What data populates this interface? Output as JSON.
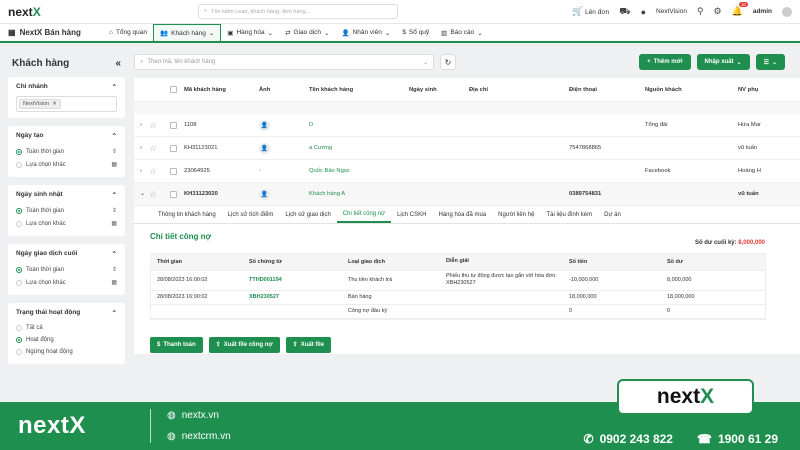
{
  "topbar": {
    "logo_main": "next",
    "logo_x": "X",
    "search_placeholder": "Tìm kiếm Lead, khách hàng, đơn hàng...",
    "order_label": "Lên đơn",
    "company": "NextVision",
    "notif_count": "10",
    "user": "admin"
  },
  "nav": {
    "brand": "NextX Bán hàng",
    "items": [
      "Tổng quan",
      "Khách hàng",
      "Hàng hóa",
      "Giao dịch",
      "Nhân viên",
      "Sổ quỹ",
      "Báo cáo"
    ]
  },
  "sidebar": {
    "title": "Khách hàng",
    "branch": {
      "title": "Chi nhánh",
      "tag": "NextVision"
    },
    "created": {
      "title": "Ngày tạo",
      "opt1": "Toàn thời gian",
      "opt2": "Lựa chọn khác"
    },
    "birthday": {
      "title": "Ngày sinh nhật",
      "opt1": "Toàn thời gian",
      "opt2": "Lựa chọn khác"
    },
    "last_txn": {
      "title": "Ngày giao dịch cuối",
      "opt1": "Toàn thời gian",
      "opt2": "Lựa chọn khác"
    },
    "status": {
      "title": "Trạng thái hoạt động",
      "opt1": "Tất cả",
      "opt2": "Hoạt động",
      "opt3": "Ngừng hoạt động"
    }
  },
  "main": {
    "search_placeholder": "Theo mã, tên khách hàng",
    "add_label": "Thêm mới",
    "import_label": "Nhập xuất",
    "columns": [
      "Mã khách hàng",
      "Ảnh",
      "Tên khách hàng",
      "Ngày sinh",
      "Địa chỉ",
      "Điện thoại",
      "Nguồn khách",
      "NV phụ"
    ],
    "rows": [
      {
        "code": "1108",
        "name": "D",
        "phone": "",
        "source": "Tổng đài",
        "staff": "Hứa Mar"
      },
      {
        "code": "KH31123021",
        "name": "a Cường",
        "phone": "7547868865",
        "source": "",
        "staff": "vũ tuấn"
      },
      {
        "code": "23064925",
        "name": "Quốc Bảo Ngọc",
        "phone": "",
        "source": "Facebook",
        "staff": "Hoàng H"
      },
      {
        "code": "KH31123020",
        "name": "Khách hàng A",
        "phone": "0389754831",
        "source": "",
        "staff": "vũ tuấn"
      }
    ],
    "tabs": [
      "Thông tin khách hàng",
      "Lịch sử tích điểm",
      "Lịch sử giao dịch",
      "Chi tiết công nợ",
      "Lịch CSKH",
      "Hàng hóa đã mua",
      "Người liên hệ",
      "Tài liệu đính kèm",
      "Dự án"
    ],
    "detail": {
      "title": "Chi tiết công nợ",
      "balance_label": "Số dư cuối kỳ:",
      "balance_value": "8,000,000",
      "columns": [
        "Thời gian",
        "Số chứng từ",
        "Loại giao dịch",
        "Diễn giải",
        "Số tiền",
        "Số dư"
      ],
      "rows": [
        {
          "time": "28/08/2023 16:00:02",
          "doc": "TTHD001194",
          "type": "Thu tiền khách trả",
          "desc": "Phiếu thu tự động được tạo gắn với hóa đơn: XBH230527",
          "amount": "-10,000,000",
          "balance": "8,000,000"
        },
        {
          "time": "28/08/2023 16:00:02",
          "doc": "XBH230527",
          "type": "Bán hàng",
          "desc": "",
          "amount": "18,000,000",
          "balance": "18,000,000"
        },
        {
          "time": "",
          "doc": "",
          "type": "Công nợ đầu kỳ",
          "desc": "",
          "amount": "0",
          "balance": "0"
        }
      ],
      "btn_pay": "Thanh toán",
      "btn_export_debt": "Xuất file công nợ",
      "btn_export": "Xuất file"
    }
  },
  "footer": {
    "logo": "nextX",
    "link1": "nextx.vn",
    "link2": "nextcrm.vn",
    "phone1": "0902 243 822",
    "phone2": "1900 61 29",
    "badge_main": "next",
    "badge_x": "X"
  },
  "colors": {
    "accent": "#1e8f4e",
    "danger": "#e53935"
  }
}
